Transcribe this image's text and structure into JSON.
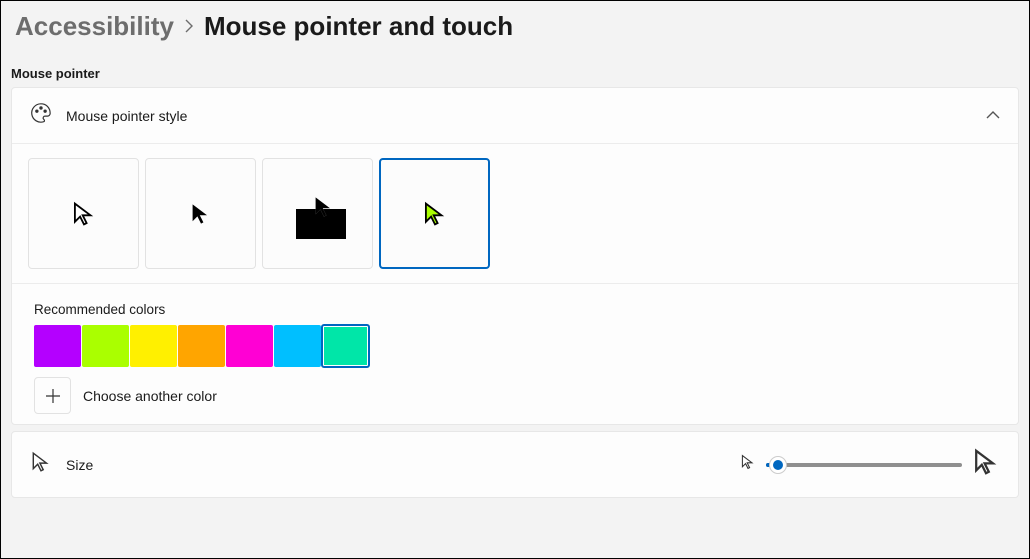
{
  "breadcrumb": {
    "parent": "Accessibility",
    "current": "Mouse pointer and touch"
  },
  "section_label": "Mouse pointer",
  "style_card": {
    "title": "Mouse pointer style",
    "styles": [
      "white",
      "black",
      "inverted",
      "custom"
    ],
    "selected_index": 3
  },
  "colors": {
    "label": "Recommended colors",
    "swatches": [
      "#b400ff",
      "#aaff00",
      "#fff000",
      "#ffa500",
      "#ff00d4",
      "#00bfff",
      "#00e6a8"
    ],
    "selected_index": 6,
    "choose_label": "Choose another color"
  },
  "size": {
    "label": "Size",
    "min": 1,
    "max": 15,
    "value": 1,
    "percent": 6
  }
}
